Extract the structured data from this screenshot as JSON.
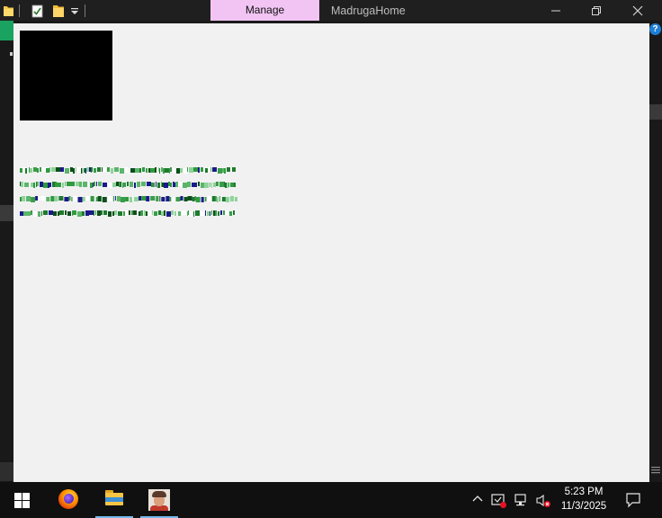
{
  "titlebar": {
    "context_tab": "Manage",
    "window_title": "MadrugaHome"
  },
  "clock": {
    "time": "5:23 PM",
    "date": "11/3/2025"
  },
  "help": {
    "glyph": "?"
  },
  "colors": {
    "manage_tab_bg": "#f1c4f3",
    "viewer_bg": "#f1f1f1",
    "taskbar_bg": "#101010",
    "active_underline": "#76b9ed"
  },
  "icons": {
    "quick_access": [
      "folder-icon",
      "properties-check-icon",
      "new-folder-icon",
      "customize-dropdown-icon"
    ],
    "window_controls": [
      "minimize-icon",
      "restore-icon",
      "close-icon"
    ],
    "taskbar_apps": [
      "firefox-icon",
      "file-explorer-icon",
      "user-avatar-icon"
    ],
    "tray": [
      "chevron-up-icon",
      "security-alert-icon",
      "network-icon",
      "volume-muted-icon",
      "notifications-icon"
    ]
  }
}
